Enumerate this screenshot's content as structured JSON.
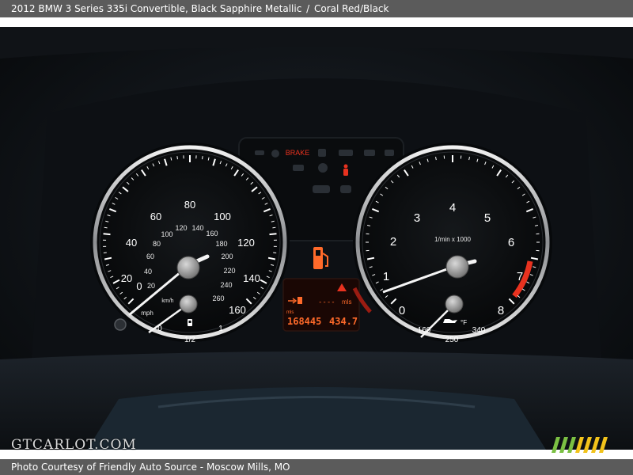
{
  "header": {
    "vehicle": "2012 BMW 3 Series 335i Convertible,",
    "exterior": "Black Sapphire Metallic",
    "separator": "/",
    "interior": "Coral Red/Black"
  },
  "footer": {
    "credit": "Photo Courtesy of Friendly Auto Source - Moscow Mills, MO"
  },
  "watermark": {
    "text": "GTCARLOT.COM"
  },
  "cluster": {
    "speedometer": {
      "mph_labels": [
        "0",
        "20",
        "40",
        "60",
        "80",
        "100",
        "120",
        "140",
        "160"
      ],
      "kmh_labels": [
        "20",
        "40",
        "60",
        "80",
        "100",
        "120",
        "140",
        "160",
        "180",
        "200",
        "220",
        "240",
        "260"
      ],
      "unit_mph": "mph",
      "unit_kmh": "km/h"
    },
    "tachometer": {
      "labels": [
        "0",
        "1",
        "2",
        "3",
        "4",
        "5",
        "6",
        "7",
        "8"
      ],
      "unit": "1/min x 1000"
    },
    "fuel_gauge": {
      "empty": "0",
      "half": "1/2",
      "full": "1"
    },
    "oil_temp_gauge": {
      "low": "160",
      "mid": "250",
      "high": "340",
      "unit": "°F"
    },
    "warning_text": "BRAKE",
    "trip_dashes": "----",
    "trip_unit": "mls",
    "odometer_unit": "mls",
    "odometer": "168445",
    "trip_meter": "434.7"
  },
  "colors": {
    "accent_red": "#e8321f",
    "display_amber": "#ff6a2a",
    "banner_gray": "#5b5b5b",
    "logo_green": "#7bc043",
    "logo_yellow": "#f2c31b"
  }
}
